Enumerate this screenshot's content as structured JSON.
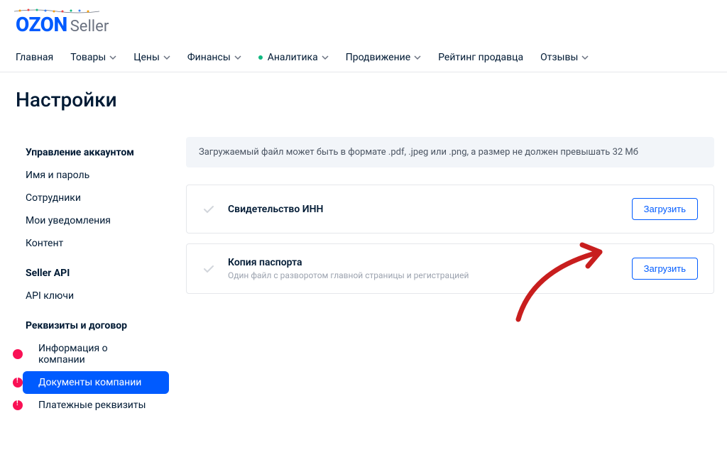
{
  "logo": {
    "brand": "OZON",
    "suffix": "Seller"
  },
  "nav": {
    "items": [
      {
        "label": "Главная",
        "dropdown": false
      },
      {
        "label": "Товары",
        "dropdown": true
      },
      {
        "label": "Цены",
        "dropdown": true
      },
      {
        "label": "Финансы",
        "dropdown": true
      },
      {
        "label": "Аналитика",
        "dropdown": true,
        "badge": true
      },
      {
        "label": "Продвижение",
        "dropdown": true
      },
      {
        "label": "Рейтинг продавца",
        "dropdown": false
      },
      {
        "label": "Отзывы",
        "dropdown": true
      }
    ]
  },
  "page_title": "Настройки",
  "sidebar": {
    "sections": [
      {
        "heading": "Управление аккаунтом",
        "items": [
          {
            "label": "Имя и пароль"
          },
          {
            "label": "Сотрудники"
          },
          {
            "label": "Мои уведомления"
          },
          {
            "label": "Контент"
          }
        ]
      },
      {
        "heading": "Seller API",
        "items": [
          {
            "label": "API ключи"
          }
        ]
      },
      {
        "heading": "Реквизиты и договор",
        "items": [
          {
            "label": "Информация о компании",
            "alert": true
          },
          {
            "label": "Документы компании",
            "alert": true,
            "active": true
          },
          {
            "label": "Платежные реквизиты",
            "alert": true
          }
        ]
      }
    ]
  },
  "main": {
    "info_banner": "Загружаемый файл может быть в формате .pdf, .jpeg или .png, а размер не должен превышать 32 Мб",
    "docs": [
      {
        "title": "Свидетельство ИНН",
        "subtitle": "",
        "upload_label": "Загрузить"
      },
      {
        "title": "Копия паспорта",
        "subtitle": "Один файл с разворотом главной страницы и регистрацией",
        "upload_label": "Загрузить"
      }
    ]
  }
}
